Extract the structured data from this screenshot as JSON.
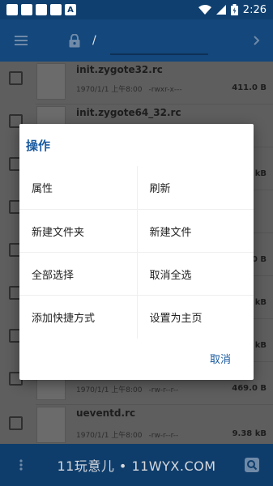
{
  "status_bar": {
    "time": "2:26"
  },
  "toolbar": {
    "path": "/"
  },
  "files": [
    {
      "name": "init.zygote32.rc",
      "date": "1970/1/1 上午8:00",
      "perm": "-rwxr-x---",
      "size": "411.0 B"
    },
    {
      "name": "init.zygote64_32.rc",
      "date": "",
      "perm": "",
      "size": ""
    },
    {
      "name": "",
      "date": "",
      "perm": "",
      "size": "kB"
    },
    {
      "name": "",
      "date": "",
      "perm": "",
      "size": ""
    },
    {
      "name": "",
      "date": "",
      "perm": "",
      "size": "0 B"
    },
    {
      "name": "",
      "date": "",
      "perm": "",
      "size": "kB"
    },
    {
      "name": "",
      "date": "",
      "perm": "",
      "size": "kB"
    },
    {
      "name": "",
      "date": "1970/1/1 上午8:00",
      "perm": "-rw-r--r--",
      "size": "469.0 B"
    },
    {
      "name": "ueventd.rc",
      "date": "1970/1/1 上午8:00",
      "perm": "-rw-r--r--",
      "size": "9.38 kB"
    }
  ],
  "dialog": {
    "title": "操作",
    "actions": [
      [
        "属性",
        "刷新"
      ],
      [
        "新建文件夹",
        "新建文件"
      ],
      [
        "全部选择",
        "取消全选"
      ],
      [
        "添加快捷方式",
        "设置为主页"
      ]
    ],
    "cancel": "取消"
  },
  "bottom_bar": {
    "watermark": "11玩意儿 • 11WYX.COM"
  }
}
